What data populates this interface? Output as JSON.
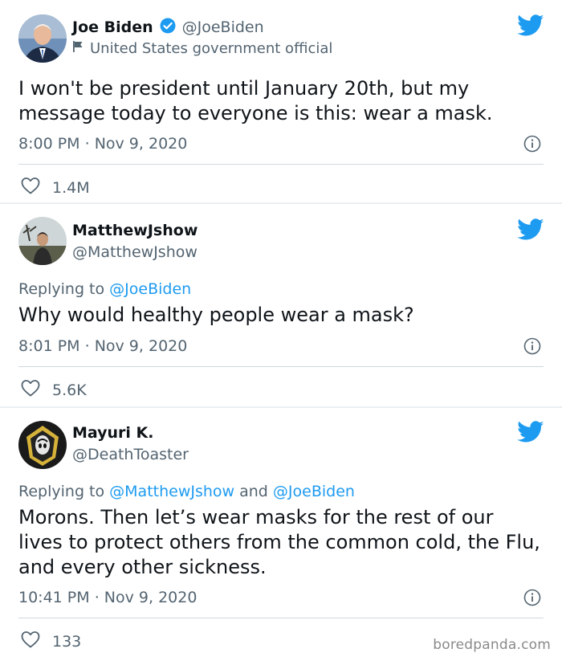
{
  "tweets": [
    {
      "name": "Joe Biden",
      "handle": "@JoeBiden",
      "label": "United States government official",
      "text": "I won't be president until January 20th, but my message today to everyone is this: wear a mask.",
      "time": "8:00 PM",
      "date": "Nov 9, 2020",
      "likes": "1.4M"
    },
    {
      "name": "MatthewJshow",
      "handle": "@MatthewJshow",
      "replying_prefix": "Replying to ",
      "replying_to": "@JoeBiden",
      "text": "Why would healthy people wear a mask?",
      "time": "8:01 PM",
      "date": "Nov 9, 2020",
      "likes": "5.6K"
    },
    {
      "name": "Mayuri K.",
      "handle": "@DeathToaster",
      "replying_prefix": "Replying to ",
      "replying_to_1": "@MatthewJshow",
      "replying_and": " and ",
      "replying_to_2": "@JoeBiden",
      "text": "Morons. Then let’s wear masks for the rest of our lives to protect others from the common cold, the Flu, and every other sickness.",
      "time": "10:41 PM",
      "date": "Nov 9, 2020",
      "likes": "133"
    }
  ],
  "meta_separator": " · ",
  "watermark": "boredpanda.com",
  "colors": {
    "accent": "#1d9bf0",
    "muted": "#536471",
    "text": "#0f1419"
  }
}
